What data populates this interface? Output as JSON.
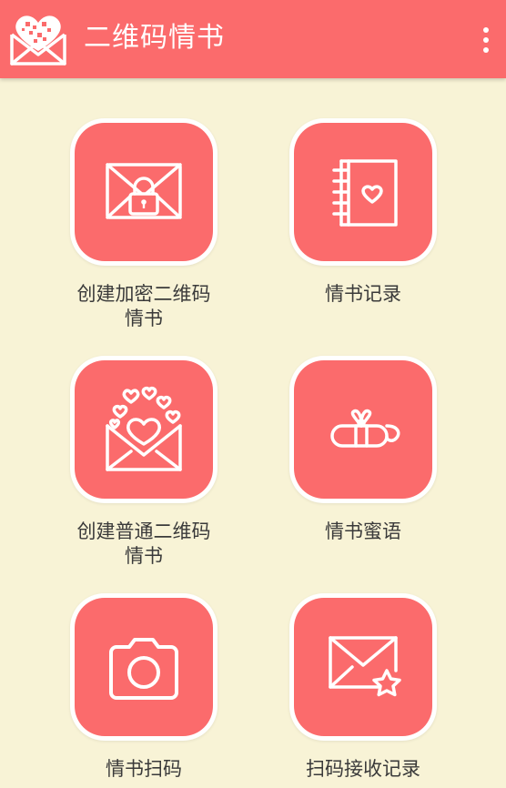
{
  "app": {
    "title": "二维码情书",
    "theme_color": "#fb6b6c",
    "background_color": "#f8f3d6"
  },
  "menu": {
    "icon": "overflow-menu-icon"
  },
  "tiles": [
    {
      "label": "创建加密二维码\n情书",
      "icon": "locked-envelope-icon"
    },
    {
      "label": "情书记录",
      "icon": "heart-notebook-icon"
    },
    {
      "label": "创建普通二维码\n情书",
      "icon": "hearts-envelope-icon"
    },
    {
      "label": "情书蜜语",
      "icon": "ribbon-scroll-icon"
    },
    {
      "label": "情书扫码",
      "icon": "camera-icon"
    },
    {
      "label": "扫码接收记录",
      "icon": "envelope-star-icon"
    }
  ]
}
